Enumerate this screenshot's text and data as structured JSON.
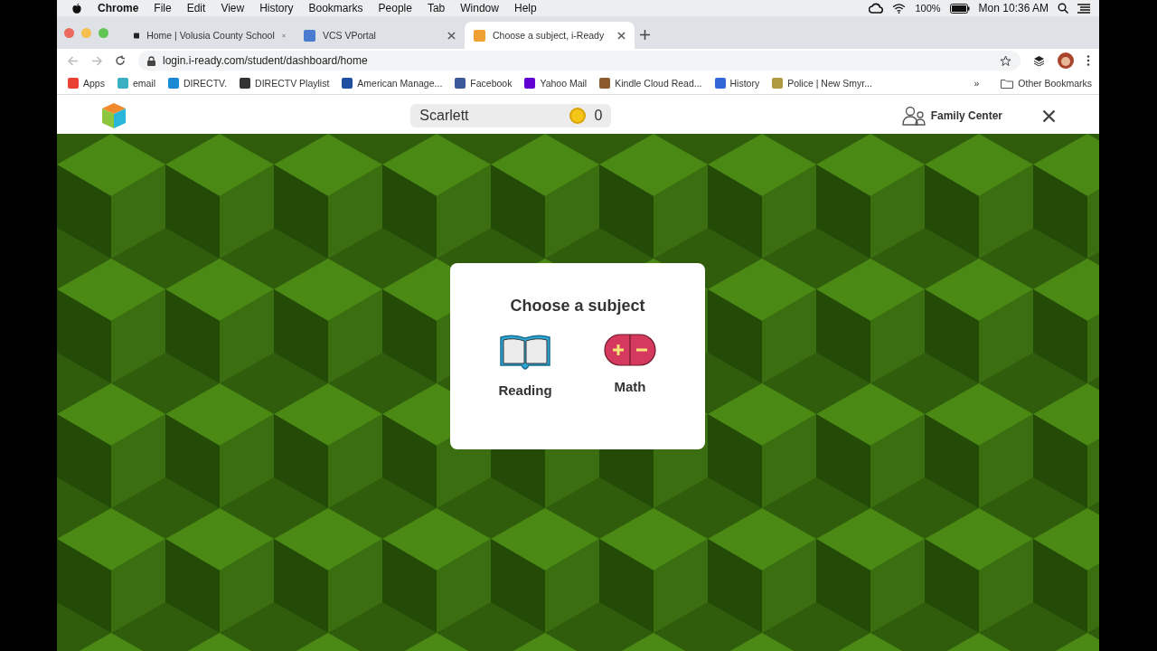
{
  "menu_bar": {
    "app": "Chrome",
    "menus": [
      "File",
      "Edit",
      "View",
      "History",
      "Bookmarks",
      "People",
      "Tab",
      "Window",
      "Help"
    ],
    "battery": "100%",
    "clock": "Mon 10:36 AM"
  },
  "tabs": [
    {
      "title": "Home | Volusia County School",
      "selected": false
    },
    {
      "title": "VCS VPortal",
      "selected": false
    },
    {
      "title": "Choose a subject, i-Ready",
      "selected": true
    }
  ],
  "address": "login.i-ready.com/student/dashboard/home",
  "bookmarks": [
    "Apps",
    "email",
    "DIRECTV.",
    "DIRECTV Playlist",
    "American Manage...",
    "Facebook",
    "Yahoo Mail",
    "Kindle Cloud Read...",
    "History",
    "Police | New Smyr..."
  ],
  "bookmarks_overflow": "»",
  "other_bookmarks": "Other Bookmarks",
  "app_header": {
    "student": "Scarlett",
    "coins": "0",
    "family": "Family Center"
  },
  "dialog": {
    "title": "Choose a subject",
    "subjects": [
      {
        "label": "Reading",
        "kind": "reading"
      },
      {
        "label": "Math",
        "kind": "math"
      }
    ]
  }
}
